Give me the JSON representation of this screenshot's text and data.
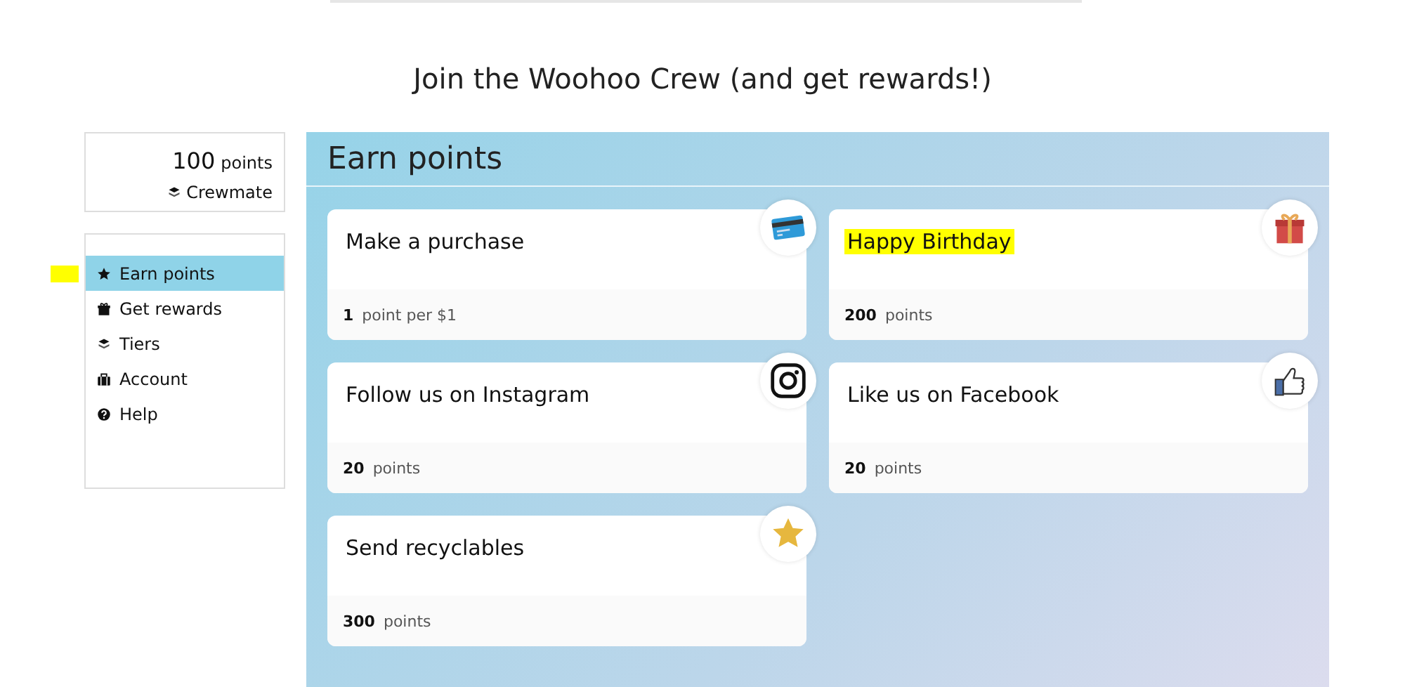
{
  "page_title": "Join the Woohoo Crew (and get rewards!)",
  "account_summary": {
    "points": "100",
    "points_unit": "points",
    "tier": "Crewmate"
  },
  "nav": [
    {
      "label": "Earn points",
      "selected": true,
      "marked": true
    },
    {
      "label": "Get rewards",
      "selected": false,
      "marked": false
    },
    {
      "label": "Tiers",
      "selected": false,
      "marked": false
    },
    {
      "label": "Account",
      "selected": false,
      "marked": false
    },
    {
      "label": "Help",
      "selected": false,
      "marked": false
    }
  ],
  "panel": {
    "title": "Earn points",
    "cards": [
      {
        "title": "Make a purchase",
        "amount": "1",
        "unit": "point per $1",
        "highlighted": false
      },
      {
        "title": "Happy Birthday",
        "amount": "200",
        "unit": "points",
        "highlighted": true
      },
      {
        "title": "Follow us on Instagram",
        "amount": "20",
        "unit": "points",
        "highlighted": false
      },
      {
        "title": "Like us on Facebook",
        "amount": "20",
        "unit": "points",
        "highlighted": false
      },
      {
        "title": "Send recyclables",
        "amount": "300",
        "unit": "points",
        "highlighted": false
      }
    ]
  }
}
